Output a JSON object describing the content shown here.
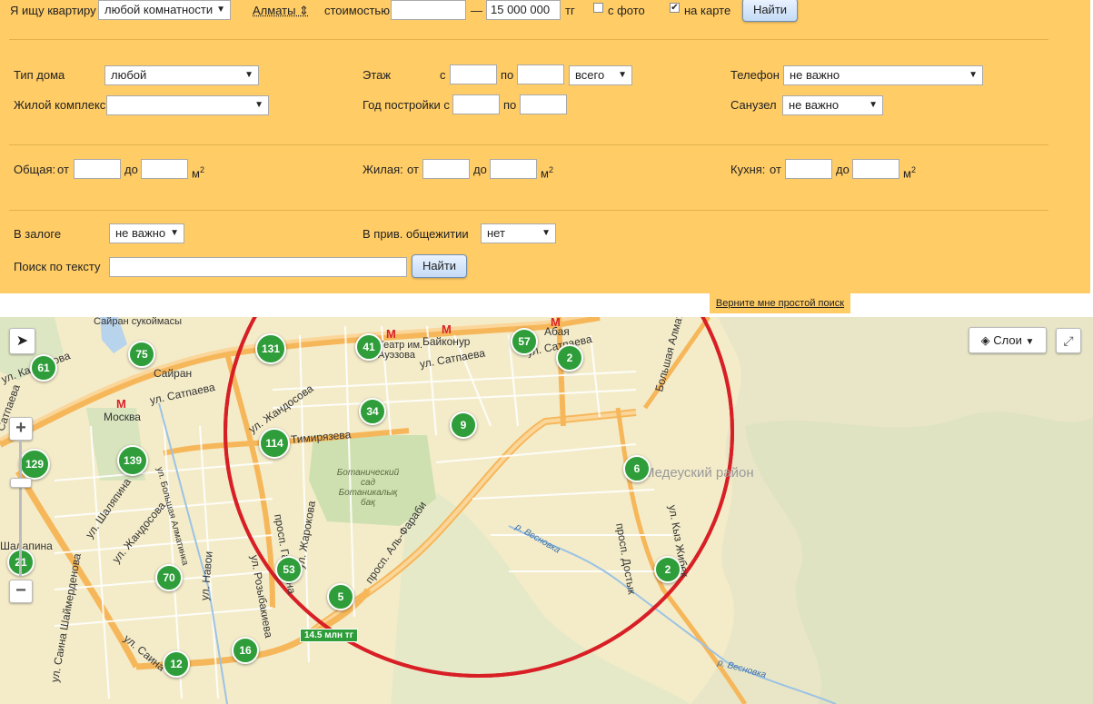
{
  "search": {
    "looking_for_label": "Я ищу квартиру",
    "rooms_value": "любой комнатности",
    "city_link": "Алматы ⇕",
    "price_label": "стоимостью",
    "price_from": "",
    "price_dash": "—",
    "price_to": "15 000 000",
    "currency": "тг",
    "photo_label": "с фото",
    "map_label": "на карте",
    "find_button": "Найти"
  },
  "filters": {
    "house_type_label": "Тип дома",
    "house_type_value": "любой",
    "complex_label": "Жилой комплекс",
    "complex_value": "",
    "floor_label": "Этаж",
    "floor_from_label": "с",
    "floor_to_label": "по",
    "floor_total_value": "всего",
    "year_label": "Год постройки с",
    "year_to_label": "по",
    "phone_label": "Телефон",
    "phone_value": "не важно",
    "bathroom_label": "Санузел",
    "bathroom_value": "не важно",
    "total_area_label": "Общая:",
    "living_area_label": "Жилая:",
    "kitchen_area_label": "Кухня:",
    "from_label": "от",
    "to_label": "до",
    "unit": "м",
    "unit_sup": "2",
    "pledge_label": "В залоге",
    "pledge_value": "не важно",
    "dorm_label": "В прив. общежитии",
    "dorm_value": "нет",
    "text_search_label": "Поиск по тексту",
    "text_search_value": "",
    "find_button": "Найти",
    "simple_search_link": "Верните мне простой поиск"
  },
  "map": {
    "layers_button": "Слои",
    "district_label": "Медеуский район",
    "garden_label": "Ботанический сад Ботаникалық бақ",
    "distance_label": "14.5 млн тг",
    "clusters": [
      {
        "label": "61"
      },
      {
        "label": "75"
      },
      {
        "label": "131"
      },
      {
        "label": "41"
      },
      {
        "label": "57"
      },
      {
        "label": "2"
      },
      {
        "label": "34"
      },
      {
        "label": "9"
      },
      {
        "label": "114"
      },
      {
        "label": "129"
      },
      {
        "label": "139"
      },
      {
        "label": "6"
      },
      {
        "label": "21"
      },
      {
        "label": "70"
      },
      {
        "label": "53"
      },
      {
        "label": "5"
      },
      {
        "label": "2"
      },
      {
        "label": "16"
      },
      {
        "label": "12"
      }
    ],
    "streets": [
      {
        "name": "Сайран сукоймасы"
      },
      {
        "name": "ул. Кабдолова"
      },
      {
        "name": "Сайран"
      },
      {
        "name": "Москва"
      },
      {
        "name": "ул. Сатпаева"
      },
      {
        "name": "ул. Жандосова"
      },
      {
        "name": "Тимирязева"
      },
      {
        "name": "ул. Шаляпина"
      },
      {
        "name": "ул. Жандосова"
      },
      {
        "name": "ул. Навои"
      },
      {
        "name": "ул. Розыбакиева"
      },
      {
        "name": "просп. Гагарина"
      },
      {
        "name": "ул. Жарокова"
      },
      {
        "name": "просп. Аль-Фараби"
      },
      {
        "name": "Театр им. Ауэзова"
      },
      {
        "name": "Байконур"
      },
      {
        "name": "ул. Сатпаева"
      },
      {
        "name": "Абая"
      },
      {
        "name": "ул. Сатпаева"
      },
      {
        "name": "Большая Алматинка"
      },
      {
        "name": "просп. Достык"
      },
      {
        "name": "ул. Кыз Жибек"
      },
      {
        "name": "р. Весновка"
      },
      {
        "name": "р. Весновка"
      },
      {
        "name": "ул. Саина"
      },
      {
        "name": "ул. Саина Шаймерденова"
      },
      {
        "name": "ул. Большая Алматинка"
      },
      {
        "name": "Шалапина"
      },
      {
        "name": "Сатпаева"
      }
    ]
  }
}
